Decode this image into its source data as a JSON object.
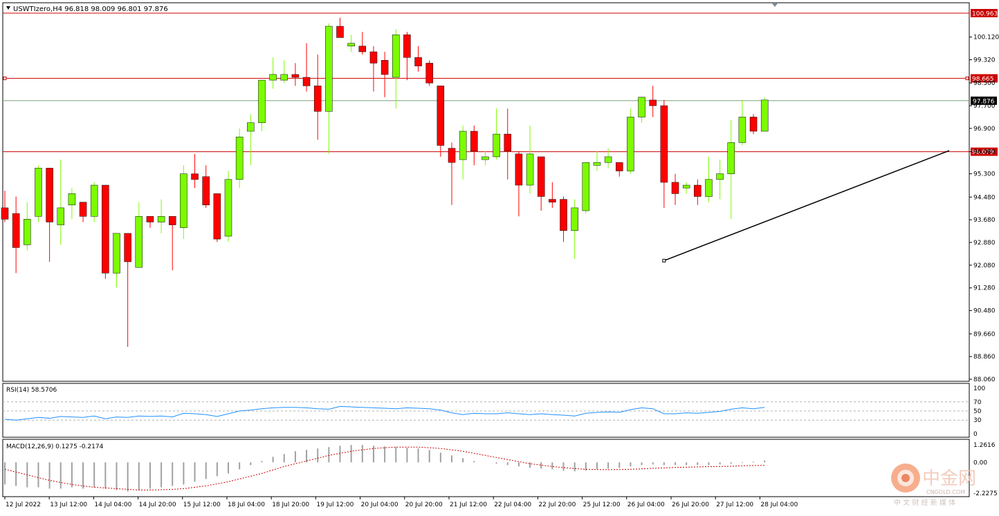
{
  "header": {
    "symbol_line": "USWTIzero,H4  96.818 98.009 96.801 97.876"
  },
  "rsi": {
    "label": "RSI(14) 58.5706",
    "levels": [
      "100",
      "70",
      "50",
      "30",
      "0"
    ]
  },
  "macd": {
    "label": "MACD(12,26,9) 0.1275 -0.2174",
    "levels": [
      "1.2616",
      "0.00",
      "-2.2275"
    ]
  },
  "watermark": {
    "text": "中金网",
    "sub": "CNGOLD.COM",
    "tagline": "中 文 财 经 新 媒 体"
  },
  "colors": {
    "bull": "#7CFC00",
    "bear": "#ff0000",
    "level_line": "#cc0000",
    "trend_line": "#000000",
    "rsi_line": "#1e90ff",
    "macd_signal": "#cc0000",
    "macd_hist": "#a0a0a0"
  },
  "chart_data": {
    "type": "candlestick",
    "title": "USWTIzero,H4",
    "y_ticks": [
      "100.120",
      "99.320",
      "98.500",
      "97.700",
      "96.900",
      "96.080",
      "95.300",
      "94.480",
      "93.680",
      "92.880",
      "92.080",
      "91.280",
      "90.480",
      "89.660",
      "88.860",
      "88.060"
    ],
    "ylim": [
      88.06,
      100.963
    ],
    "x_labels": [
      "12 Jul 2022",
      "13 Jul 12:00",
      "14 Jul 04:00",
      "14 Jul 20:00",
      "15 Jul 12:00",
      "18 Jul 04:00",
      "18 Jul 20:00",
      "19 Jul 12:00",
      "20 Jul 04:00",
      "20 Jul 20:00",
      "21 Jul 12:00",
      "22 Jul 04:00",
      "22 Jul 20:00",
      "25 Jul 12:00",
      "26 Jul 04:00",
      "26 Jul 20:00",
      "27 Jul 12:00",
      "28 Jul 04:00"
    ],
    "levels": [
      {
        "label": "100.963",
        "value": 100.963
      },
      {
        "label": "98.665",
        "value": 98.665
      },
      {
        "label": "96.079",
        "value": 96.079
      }
    ],
    "current_price": {
      "label": "97.876",
      "value": 97.876
    },
    "trendline": {
      "start": [
        59,
        92.24
      ],
      "end": [
        90,
        96.95
      ]
    },
    "candles": [
      {
        "o": 94.1,
        "h": 94.7,
        "l": 93.6,
        "c": 93.7
      },
      {
        "o": 93.9,
        "h": 94.5,
        "l": 91.8,
        "c": 92.7
      },
      {
        "o": 92.8,
        "h": 94.3,
        "l": 92.6,
        "c": 93.7
      },
      {
        "o": 93.8,
        "h": 95.6,
        "l": 93.6,
        "c": 95.5
      },
      {
        "o": 95.5,
        "h": 95.5,
        "l": 92.2,
        "c": 93.6
      },
      {
        "o": 93.5,
        "h": 95.8,
        "l": 92.8,
        "c": 94.1
      },
      {
        "o": 94.2,
        "h": 94.8,
        "l": 93.7,
        "c": 94.6
      },
      {
        "o": 94.3,
        "h": 94.3,
        "l": 93.6,
        "c": 93.8
      },
      {
        "o": 93.8,
        "h": 95.0,
        "l": 93.6,
        "c": 94.9
      },
      {
        "o": 94.9,
        "h": 94.9,
        "l": 91.6,
        "c": 91.8
      },
      {
        "o": 91.8,
        "h": 93.2,
        "l": 91.3,
        "c": 93.2
      },
      {
        "o": 93.2,
        "h": 93.2,
        "l": 89.2,
        "c": 92.2
      },
      {
        "o": 92.0,
        "h": 94.3,
        "l": 92.0,
        "c": 93.8
      },
      {
        "o": 93.8,
        "h": 93.8,
        "l": 93.4,
        "c": 93.6
      },
      {
        "o": 93.6,
        "h": 94.4,
        "l": 93.2,
        "c": 93.8
      },
      {
        "o": 93.8,
        "h": 93.8,
        "l": 91.9,
        "c": 93.5
      },
      {
        "o": 93.4,
        "h": 95.6,
        "l": 93.0,
        "c": 95.3
      },
      {
        "o": 95.3,
        "h": 96.0,
        "l": 94.8,
        "c": 95.1
      },
      {
        "o": 95.2,
        "h": 95.6,
        "l": 94.1,
        "c": 94.2
      },
      {
        "o": 94.6,
        "h": 94.6,
        "l": 92.9,
        "c": 93.0
      },
      {
        "o": 93.1,
        "h": 95.4,
        "l": 92.9,
        "c": 95.1
      },
      {
        "o": 95.1,
        "h": 96.9,
        "l": 94.8,
        "c": 96.6
      },
      {
        "o": 96.8,
        "h": 97.4,
        "l": 95.6,
        "c": 97.1
      },
      {
        "o": 97.1,
        "h": 98.6,
        "l": 96.8,
        "c": 98.6
      },
      {
        "o": 98.6,
        "h": 99.4,
        "l": 98.3,
        "c": 98.8
      },
      {
        "o": 98.6,
        "h": 99.3,
        "l": 98.5,
        "c": 98.8
      },
      {
        "o": 98.8,
        "h": 99.2,
        "l": 98.4,
        "c": 98.7
      },
      {
        "o": 98.7,
        "h": 99.9,
        "l": 98.2,
        "c": 98.4
      },
      {
        "o": 98.4,
        "h": 99.5,
        "l": 96.5,
        "c": 97.5
      },
      {
        "o": 97.5,
        "h": 100.6,
        "l": 96.0,
        "c": 100.5
      },
      {
        "o": 100.5,
        "h": 100.8,
        "l": 100.1,
        "c": 100.1
      },
      {
        "o": 99.8,
        "h": 100.2,
        "l": 99.6,
        "c": 99.9
      },
      {
        "o": 99.8,
        "h": 100.3,
        "l": 99.5,
        "c": 99.6
      },
      {
        "o": 99.6,
        "h": 99.8,
        "l": 98.2,
        "c": 99.2
      },
      {
        "o": 99.3,
        "h": 99.6,
        "l": 98.0,
        "c": 98.8
      },
      {
        "o": 98.7,
        "h": 100.4,
        "l": 97.6,
        "c": 100.2
      },
      {
        "o": 100.2,
        "h": 100.3,
        "l": 98.6,
        "c": 99.4
      },
      {
        "o": 99.4,
        "h": 99.8,
        "l": 98.9,
        "c": 99.1
      },
      {
        "o": 99.2,
        "h": 99.3,
        "l": 98.4,
        "c": 98.5
      },
      {
        "o": 98.4,
        "h": 98.4,
        "l": 95.9,
        "c": 96.3
      },
      {
        "o": 96.2,
        "h": 96.4,
        "l": 94.2,
        "c": 95.7
      },
      {
        "o": 95.8,
        "h": 97.0,
        "l": 95.1,
        "c": 96.8
      },
      {
        "o": 96.8,
        "h": 97.0,
        "l": 95.6,
        "c": 96.1
      },
      {
        "o": 95.8,
        "h": 96.1,
        "l": 95.6,
        "c": 95.9
      },
      {
        "o": 95.9,
        "h": 97.6,
        "l": 95.8,
        "c": 96.7
      },
      {
        "o": 96.7,
        "h": 97.6,
        "l": 95.1,
        "c": 96.1
      },
      {
        "o": 96.0,
        "h": 96.1,
        "l": 93.8,
        "c": 94.9
      },
      {
        "o": 94.9,
        "h": 97.0,
        "l": 94.6,
        "c": 96.0
      },
      {
        "o": 95.9,
        "h": 95.9,
        "l": 94.0,
        "c": 94.5
      },
      {
        "o": 94.4,
        "h": 95.0,
        "l": 94.1,
        "c": 94.3
      },
      {
        "o": 94.4,
        "h": 94.5,
        "l": 92.9,
        "c": 93.3
      },
      {
        "o": 93.3,
        "h": 94.4,
        "l": 92.3,
        "c": 94.1
      },
      {
        "o": 94.0,
        "h": 95.7,
        "l": 93.9,
        "c": 95.7
      },
      {
        "o": 95.6,
        "h": 96.1,
        "l": 95.4,
        "c": 95.7
      },
      {
        "o": 95.7,
        "h": 96.2,
        "l": 95.5,
        "c": 95.9
      },
      {
        "o": 95.7,
        "h": 95.7,
        "l": 95.2,
        "c": 95.4
      },
      {
        "o": 95.4,
        "h": 97.6,
        "l": 95.3,
        "c": 97.3
      },
      {
        "o": 97.3,
        "h": 98.0,
        "l": 97.1,
        "c": 98.0
      },
      {
        "o": 97.9,
        "h": 98.4,
        "l": 97.3,
        "c": 97.7
      },
      {
        "o": 97.7,
        "h": 97.9,
        "l": 94.1,
        "c": 95.0
      },
      {
        "o": 95.0,
        "h": 95.3,
        "l": 94.2,
        "c": 94.6
      },
      {
        "o": 94.8,
        "h": 95.0,
        "l": 94.6,
        "c": 94.9
      },
      {
        "o": 94.9,
        "h": 95.1,
        "l": 94.2,
        "c": 94.5
      },
      {
        "o": 94.5,
        "h": 95.9,
        "l": 94.3,
        "c": 95.1
      },
      {
        "o": 95.1,
        "h": 95.8,
        "l": 94.4,
        "c": 95.3
      },
      {
        "o": 95.3,
        "h": 97.2,
        "l": 93.7,
        "c": 96.4
      },
      {
        "o": 96.4,
        "h": 97.9,
        "l": 96.3,
        "c": 97.3
      },
      {
        "o": 97.3,
        "h": 97.4,
        "l": 96.7,
        "c": 96.8
      },
      {
        "o": 96.8,
        "h": 98.0,
        "l": 96.8,
        "c": 97.9
      }
    ],
    "rsi_values": [
      32,
      30,
      33,
      36,
      34,
      38,
      37,
      36,
      39,
      33,
      37,
      36,
      39,
      38,
      39,
      37,
      45,
      44,
      42,
      38,
      44,
      50,
      52,
      55,
      57,
      58,
      58,
      57,
      55,
      54,
      60,
      59,
      58,
      57,
      56,
      55,
      57,
      56,
      55,
      52,
      46,
      42,
      45,
      44,
      44,
      46,
      44,
      42,
      44,
      42,
      41,
      39,
      45,
      47,
      48,
      47,
      53,
      57,
      55,
      44,
      44,
      46,
      45,
      47,
      49,
      54,
      57,
      55,
      58
    ],
    "macd_hist": [
      -1.6,
      -1.7,
      -1.8,
      -1.8,
      -1.9,
      -1.9,
      -1.8,
      -1.9,
      -1.8,
      -1.9,
      -2.0,
      -2.1,
      -2.0,
      -1.9,
      -1.8,
      -1.7,
      -1.6,
      -1.4,
      -1.2,
      -1.0,
      -0.8,
      -0.5,
      -0.2,
      0.1,
      0.4,
      0.6,
      0.8,
      0.9,
      1.0,
      1.1,
      1.2,
      1.25,
      1.26,
      1.2,
      1.15,
      1.1,
      1.05,
      1.0,
      0.9,
      0.7,
      0.5,
      0.3,
      0.1,
      0.0,
      -0.1,
      -0.2,
      -0.3,
      -0.4,
      -0.45,
      -0.5,
      -0.6,
      -0.65,
      -0.6,
      -0.5,
      -0.45,
      -0.4,
      -0.3,
      -0.2,
      -0.15,
      -0.2,
      -0.2,
      -0.2,
      -0.2,
      -0.2,
      -0.15,
      -0.1,
      -0.05,
      0.05,
      0.13
    ],
    "macd_signal": [
      -0.5,
      -0.7,
      -0.9,
      -1.1,
      -1.3,
      -1.45,
      -1.6,
      -1.7,
      -1.8,
      -1.85,
      -1.9,
      -1.95,
      -2.0,
      -2.0,
      -1.98,
      -1.95,
      -1.9,
      -1.8,
      -1.7,
      -1.55,
      -1.4,
      -1.2,
      -1.0,
      -0.8,
      -0.55,
      -0.3,
      -0.1,
      0.1,
      0.3,
      0.5,
      0.65,
      0.8,
      0.9,
      1.0,
      1.05,
      1.1,
      1.1,
      1.1,
      1.05,
      1.0,
      0.9,
      0.8,
      0.65,
      0.5,
      0.35,
      0.2,
      0.05,
      -0.1,
      -0.2,
      -0.3,
      -0.38,
      -0.45,
      -0.5,
      -0.52,
      -0.53,
      -0.52,
      -0.5,
      -0.47,
      -0.43,
      -0.4,
      -0.37,
      -0.35,
      -0.33,
      -0.31,
      -0.3,
      -0.28,
      -0.25,
      -0.23,
      -0.22
    ]
  }
}
